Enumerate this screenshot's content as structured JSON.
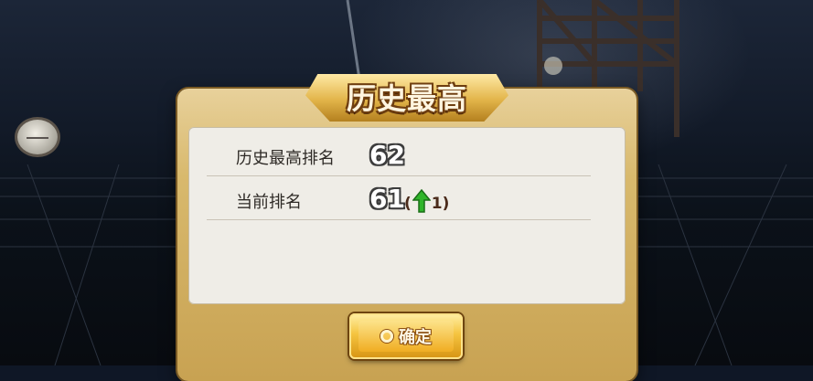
{
  "dialog": {
    "title": "历史最高",
    "rows": [
      {
        "label": "历史最高排名",
        "value": "62"
      },
      {
        "label": "当前排名",
        "value": "61",
        "change_open": "(",
        "change_amount": "1)",
        "change_direction": "up",
        "change_color": "#2fb52a"
      }
    ],
    "confirm_button": {
      "label": "确定",
      "icon": "circle-icon"
    }
  },
  "colors": {
    "panel_gold": "#d8b96d",
    "inner_panel": "#efede7",
    "button_gold": "#f5c440"
  }
}
